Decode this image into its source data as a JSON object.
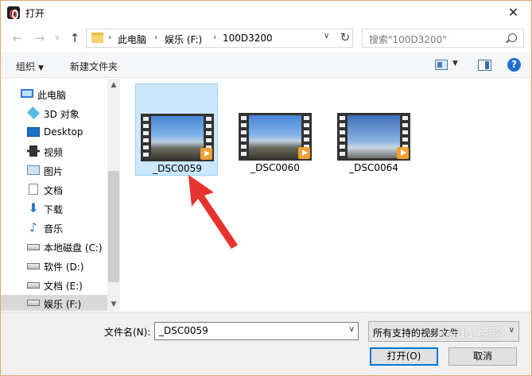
{
  "window": {
    "title": "打开",
    "close_glyph": "✕"
  },
  "nav": {
    "back": "←",
    "forward": "→",
    "recent": "∨",
    "up": "↑",
    "breadcrumbs": [
      "此电脑",
      "娱乐 (F:)",
      "100D3200"
    ],
    "sep": "›",
    "dropdown": "∨",
    "refresh": "↻",
    "search_placeholder": "搜索\"100D3200\""
  },
  "toolbar": {
    "organize": "组织",
    "organize_caret": "▼",
    "new_folder": "新建文件夹",
    "view_caret": "▼",
    "help": "?"
  },
  "sidebar": {
    "items": [
      {
        "label": "此电脑",
        "icon": "computer-icon"
      },
      {
        "label": "3D 对象",
        "icon": "3d-objects-icon"
      },
      {
        "label": "Desktop",
        "icon": "desktop-icon"
      },
      {
        "label": "视频",
        "icon": "video-folder-icon"
      },
      {
        "label": "图片",
        "icon": "pictures-icon"
      },
      {
        "label": "文档",
        "icon": "documents-icon"
      },
      {
        "label": "下载",
        "icon": "download-icon"
      },
      {
        "label": "音乐",
        "icon": "music-icon"
      },
      {
        "label": "本地磁盘 (C:)",
        "icon": "drive-icon"
      },
      {
        "label": "软件 (D:)",
        "icon": "drive-icon"
      },
      {
        "label": "文档 (E:)",
        "icon": "drive-icon"
      },
      {
        "label": "娱乐 (F:)",
        "icon": "drive-icon",
        "selected": true
      }
    ],
    "scroll_up": "▲",
    "scroll_down": "▼"
  },
  "files": [
    {
      "name": "_DSC0059",
      "selected": true
    },
    {
      "name": "_DSC0060"
    },
    {
      "name": "_DSC0064"
    }
  ],
  "bottom": {
    "filename_label": "文件名(N):",
    "filename_value": "_DSC0059",
    "dropdown": "∨",
    "filter": "所有支持的视频文件",
    "open_button": "打开(O)",
    "cancel_button": "取消"
  },
  "watermark": "Baidu 经验",
  "colors": {
    "accent": "#0078d7",
    "selection": "#cce8ff",
    "arrow": "#e8322d"
  }
}
